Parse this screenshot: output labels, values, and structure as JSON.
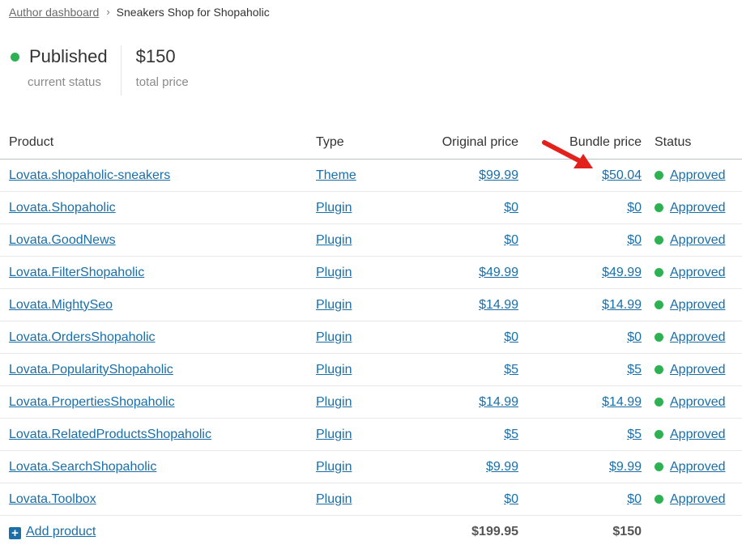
{
  "breadcrumb": {
    "parent": "Author dashboard",
    "separator": "›",
    "current": "Sneakers Shop for Shopaholic"
  },
  "summary": {
    "status_value": "Published",
    "status_label": "current status",
    "price_value": "$150",
    "price_label": "total price"
  },
  "table": {
    "headers": {
      "product": "Product",
      "type": "Type",
      "original_price": "Original price",
      "bundle_price": "Bundle price",
      "status": "Status"
    },
    "rows": [
      {
        "product": "Lovata.shopaholic-sneakers",
        "type": "Theme",
        "original_price": "$99.99",
        "bundle_price": "$50.04",
        "status": "Approved"
      },
      {
        "product": "Lovata.Shopaholic",
        "type": "Plugin",
        "original_price": "$0",
        "bundle_price": "$0",
        "status": "Approved"
      },
      {
        "product": "Lovata.GoodNews",
        "type": "Plugin",
        "original_price": "$0",
        "bundle_price": "$0",
        "status": "Approved"
      },
      {
        "product": "Lovata.FilterShopaholic",
        "type": "Plugin",
        "original_price": "$49.99",
        "bundle_price": "$49.99",
        "status": "Approved"
      },
      {
        "product": "Lovata.MightySeo",
        "type": "Plugin",
        "original_price": "$14.99",
        "bundle_price": "$14.99",
        "status": "Approved"
      },
      {
        "product": "Lovata.OrdersShopaholic",
        "type": "Plugin",
        "original_price": "$0",
        "bundle_price": "$0",
        "status": "Approved"
      },
      {
        "product": "Lovata.PopularityShopaholic",
        "type": "Plugin",
        "original_price": "$5",
        "bundle_price": "$5",
        "status": "Approved"
      },
      {
        "product": "Lovata.PropertiesShopaholic",
        "type": "Plugin",
        "original_price": "$14.99",
        "bundle_price": "$14.99",
        "status": "Approved"
      },
      {
        "product": "Lovata.RelatedProductsShopaholic",
        "type": "Plugin",
        "original_price": "$5",
        "bundle_price": "$5",
        "status": "Approved"
      },
      {
        "product": "Lovata.SearchShopaholic",
        "type": "Plugin",
        "original_price": "$9.99",
        "bundle_price": "$9.99",
        "status": "Approved"
      },
      {
        "product": "Lovata.Toolbox",
        "type": "Plugin",
        "original_price": "$0",
        "bundle_price": "$0",
        "status": "Approved"
      }
    ],
    "footer": {
      "add_product": "Add product",
      "add_icon": "plus-icon",
      "total_original": "$199.95",
      "total_bundle": "$150"
    }
  },
  "colors": {
    "link": "#1a6fa8",
    "status_green": "#2eb153",
    "annotation_arrow": "#e3211c"
  }
}
